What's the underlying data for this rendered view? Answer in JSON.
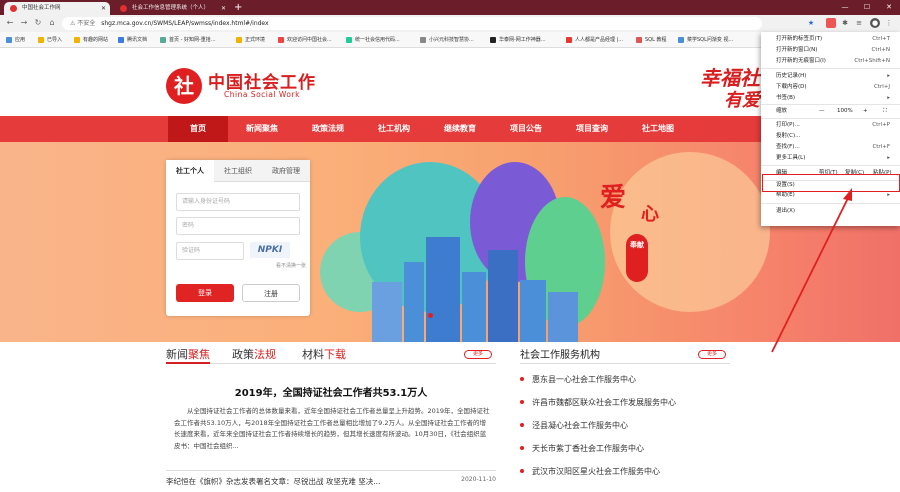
{
  "browser": {
    "tabs": [
      {
        "label": "中国社会工作网",
        "active": true
      },
      {
        "label": "社会工作信息管理系统（个人）",
        "active": false
      }
    ],
    "newtab": "+",
    "window": {
      "min": "—",
      "max": "☐",
      "close": "✕"
    },
    "address": {
      "security": "⚠ 不安全",
      "url": "shgz.mca.gov.cn/SWMS/LEAP/swmss/index.html#/index"
    },
    "bookmarks": [
      "应用",
      "已导入",
      "有趣的网站",
      "腾讯文档",
      "首页 - 好知网-重拾...",
      "正式环境",
      "欢迎访问中国社会...",
      "统一社会信用代码...",
      "小兴元科技智慧协...",
      "华泰网-网工作神器...",
      "人人都是产品经理 |...",
      "SQL 教程",
      "菜学SQL问渐变 视..."
    ]
  },
  "menu": {
    "items": [
      {
        "label": "打开新的标签页(T)",
        "shortcut": "Ctrl+T"
      },
      {
        "label": "打开新的窗口(N)",
        "shortcut": "Ctrl+N"
      },
      {
        "label": "打开新的无痕窗口(I)",
        "shortcut": "Ctrl+Shift+N"
      },
      {
        "label": "历史记录(H)",
        "shortcut": "▸"
      },
      {
        "label": "下载内容(D)",
        "shortcut": "Ctrl+J"
      },
      {
        "label": "书签(B)",
        "shortcut": "▸"
      },
      {
        "label": "打印(P)...",
        "shortcut": "Ctrl+P"
      },
      {
        "label": "投射(C)...",
        "shortcut": ""
      },
      {
        "label": "查找(F)...",
        "shortcut": "Ctrl+F"
      },
      {
        "label": "更多工具(L)",
        "shortcut": "▸"
      },
      {
        "label": "设置(S)",
        "shortcut": ""
      },
      {
        "label": "帮助(E)",
        "shortcut": "▸"
      },
      {
        "label": "退出(X)",
        "shortcut": ""
      }
    ],
    "zoom": {
      "label": "缩放",
      "minus": "—",
      "value": "100%",
      "plus": "+",
      "full": "⛶"
    },
    "edit": {
      "label": "编辑",
      "cut": "剪切(T)",
      "copy": "复制(C)",
      "paste": "粘贴(P)"
    }
  },
  "site": {
    "logo_char": "社",
    "logo_cn": "中国社会工作",
    "logo_en": "China Social Work",
    "slogan1": "幸福社",
    "slogan2": "有爱",
    "nav": [
      "首页",
      "新闻聚焦",
      "政策法规",
      "社工机构",
      "继续教育",
      "项目公告",
      "项目查询",
      "社工地图"
    ],
    "banner": {
      "ai": "爱",
      "xin": "心",
      "fengxian": "奉献"
    },
    "login": {
      "tabs": [
        "社工个人",
        "社工组织",
        "政府管理"
      ],
      "id_placeholder": "请输入身份证号码",
      "pwd_placeholder": "密码",
      "captcha_placeholder": "验证码",
      "captcha_text": "NPKI",
      "refresh": "看不清换一张",
      "login_btn": "登录",
      "register_btn": "注册"
    },
    "news_tabs": [
      {
        "pre": "新闻",
        "hl": "聚焦"
      },
      {
        "pre": "政策",
        "hl": "法规"
      },
      {
        "pre": "材料",
        "hl": "下载"
      }
    ],
    "more": "更多",
    "headline": "2019年，全国持证社会工作者共53.1万人",
    "paragraph": "从全国持证社会工作者的总体数量来看，近年全国持证社会工作者总量呈上升趋势。2019年，全国持证社会工作者共53.10万人，与2018年全国持证社会工作者总量相比增加了9.2万人。从全国持证社会工作者的增长速度来看，近年来全国持证社会工作者持续增长的趋势，但其增长速度有所波动。10月30日，《社会组织蓝皮书：中国社会组织...",
    "news_item": {
      "title": "李纪恒在《旗帜》杂志发表署名文章：尽锐出战 攻坚克难 坚决...",
      "date": "2020-11-10"
    },
    "orgs_title": "社会工作服务机构",
    "orgs": [
      "惠东县一心社会工作服务中心",
      "许昌市魏都区联众社会工作发展服务中心",
      "泾县凝心社会工作服务中心",
      "天长市紫丁香社会工作服务中心",
      "武汉市汉阳区星火社会工作服务中心"
    ]
  }
}
